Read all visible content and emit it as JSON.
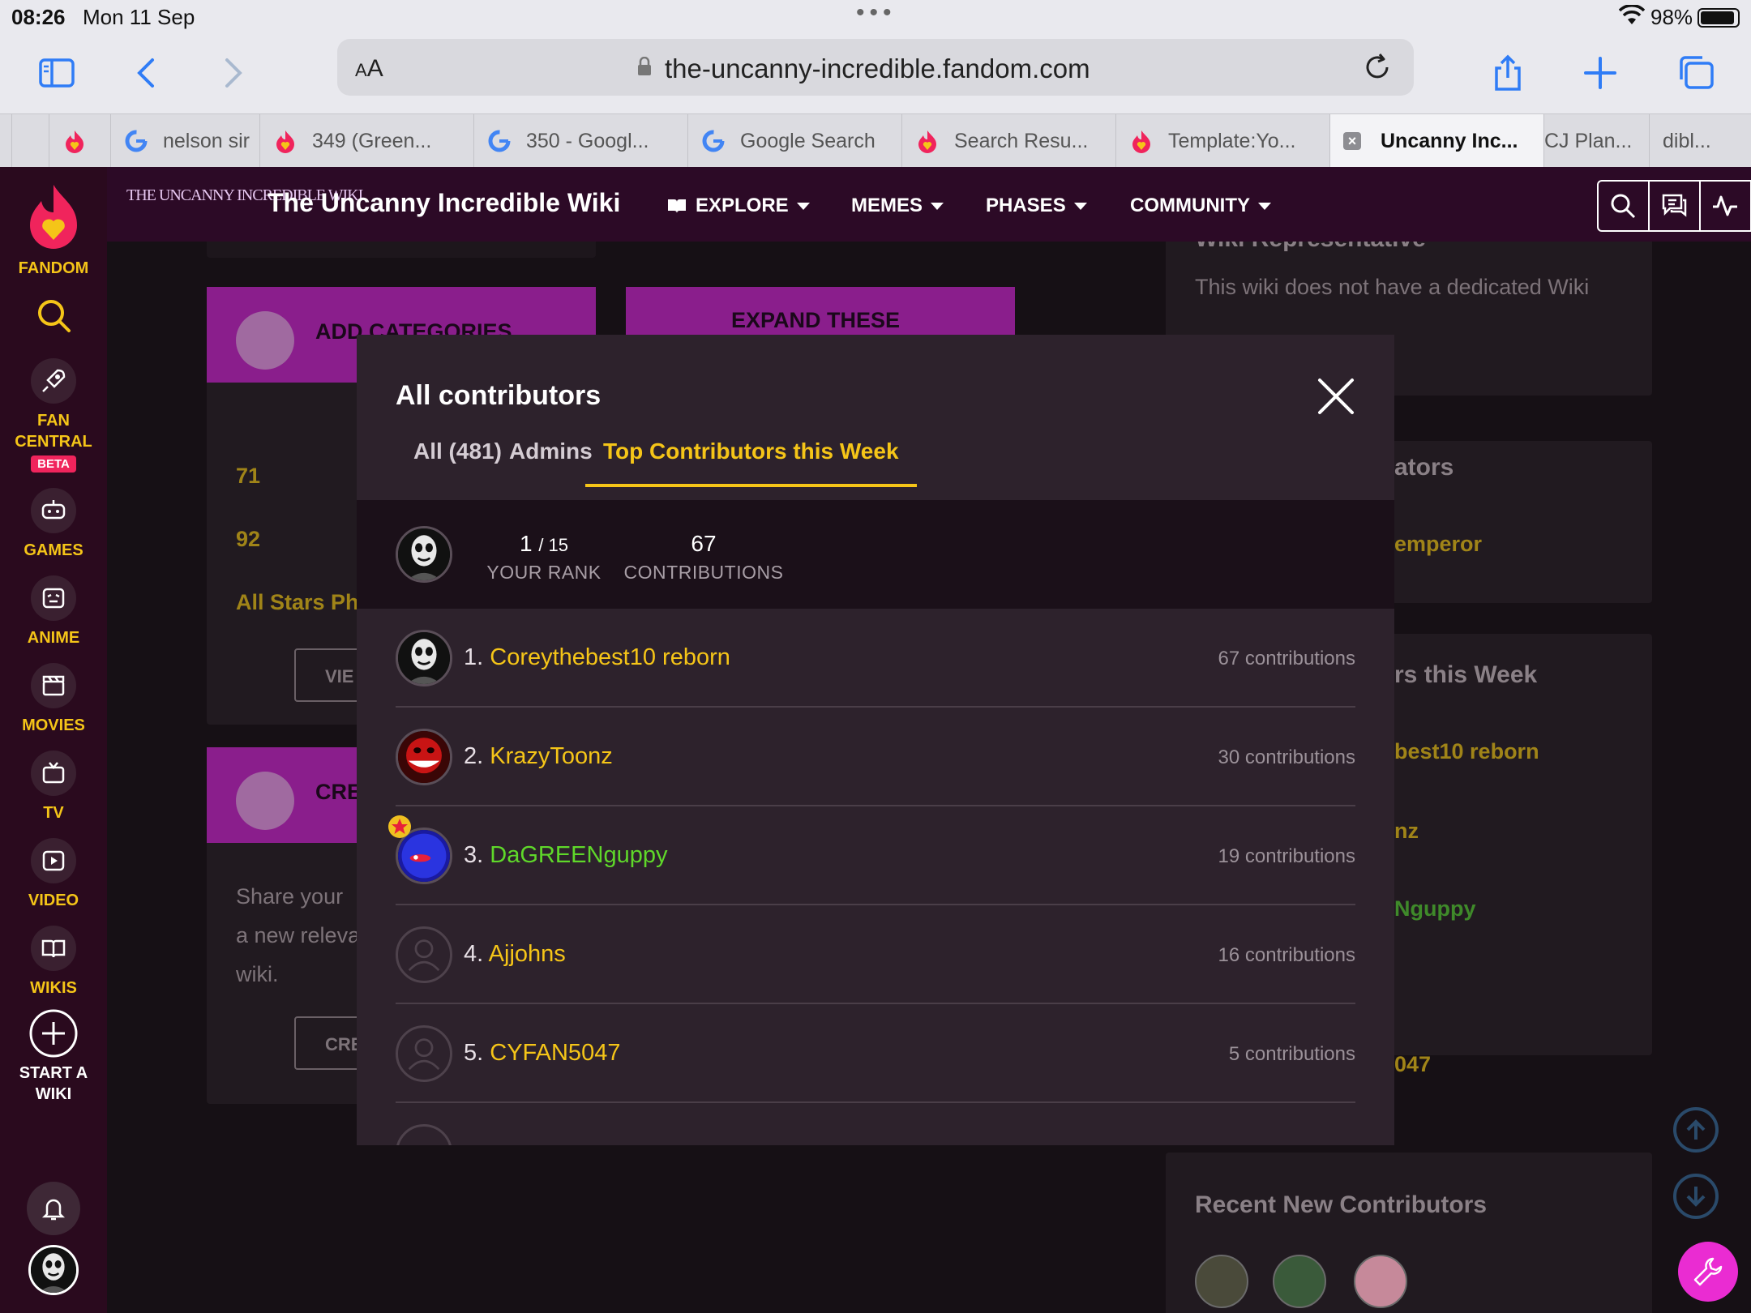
{
  "status": {
    "time": "08:26",
    "date": "Mon 11 Sep",
    "battery": "98%"
  },
  "browser": {
    "text_size_label": "AA",
    "url": "the-uncanny-incredible.fandom.com",
    "tabs": [
      {
        "title": "nelson sir",
        "icon": "google"
      },
      {
        "title": "349 (Green...",
        "icon": "fandom"
      },
      {
        "title": "350 - Googl...",
        "icon": "google"
      },
      {
        "title": "Google Search",
        "icon": "google"
      },
      {
        "title": "Search Resu...",
        "icon": "fandom"
      },
      {
        "title": "Template:Yo...",
        "icon": "fandom"
      },
      {
        "title": "Uncanny Inc...",
        "icon": "close",
        "active": true
      },
      {
        "title": "CJ Plan...",
        "icon": "none"
      },
      {
        "title": "dibl...",
        "icon": "none"
      }
    ]
  },
  "rail": {
    "brand": "FANDOM",
    "items": [
      {
        "label": "FAN\nCENTRAL",
        "badge": "BETA",
        "icon": "rocket-icon"
      },
      {
        "label": "GAMES",
        "icon": "gamepad-icon"
      },
      {
        "label": "ANIME",
        "icon": "anime-icon"
      },
      {
        "label": "MOVIES",
        "icon": "clapper-icon"
      },
      {
        "label": "TV",
        "icon": "tv-icon"
      },
      {
        "label": "VIDEO",
        "icon": "play-icon"
      },
      {
        "label": "WIKIS",
        "icon": "book-icon"
      },
      {
        "label": "START A\nWIKI",
        "icon": "plus-icon"
      }
    ]
  },
  "header": {
    "wordmark": "THE UNCANNY INCREDIBLE WIKI",
    "wiki_name": "The Uncanny Incredible Wiki",
    "nav": [
      "EXPLORE",
      "MEMES",
      "PHASES",
      "COMMUNITY"
    ]
  },
  "background": {
    "card1_title": "ADD CATEGORIES",
    "card2_title": "EXPAND THESE",
    "card3_title": "CRE",
    "num1": "71",
    "num2": "92",
    "all_stars": "All Stars Ph",
    "view_btn": "VIE",
    "create_btn": "CRE",
    "share_text": [
      "Share your",
      "a new releva",
      "wiki."
    ],
    "wiki_rep_title": "Wiki Representative",
    "wiki_rep_text": "This wiki does not have a dedicated Wiki",
    "admins_title": "ators",
    "admin_name": "emperor",
    "top_week_title": "rs this Week",
    "side_names": [
      "best10 reborn",
      "nz",
      "Nguppy",
      "047"
    ],
    "recent_title": "Recent New Contributors"
  },
  "modal": {
    "title": "All contributors",
    "tabs": [
      "All (481)",
      "Admins",
      "Top Contributors this Week"
    ],
    "active_tab": 2,
    "your_rank": {
      "value": "1",
      "total": "/ 15",
      "label": "YOUR RANK"
    },
    "your_contributions": {
      "value": "67",
      "label": "CONTRIBUTIONS"
    },
    "rows": [
      {
        "rank": "1.",
        "name": "Coreythebest10 reborn",
        "count": "67 contributions",
        "avatar": "mask",
        "color": "gold"
      },
      {
        "rank": "2.",
        "name": "KrazyToonz",
        "count": "30 contributions",
        "avatar": "red",
        "color": "gold"
      },
      {
        "rank": "3.",
        "name": "DaGREENguppy",
        "count": "19 contributions",
        "avatar": "blue",
        "color": "green",
        "star": true
      },
      {
        "rank": "4.",
        "name": "Ajjohns",
        "count": "16 contributions",
        "avatar": "default",
        "color": "gold"
      },
      {
        "rank": "5.",
        "name": "CYFAN5047",
        "count": "5 contributions",
        "avatar": "default",
        "color": "gold"
      }
    ]
  },
  "colors": {
    "accent": "#f5c518",
    "fandom_magenta": "#8a1e8c",
    "header_bg": "#2c0a26",
    "green_name": "#5fd82a"
  }
}
